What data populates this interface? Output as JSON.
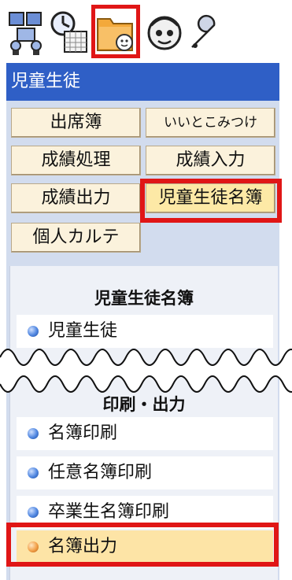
{
  "toolbar": {
    "icons": [
      "users-icon",
      "clock-calendar-icon",
      "folder-face-icon",
      "helper-face-icon",
      "wrench-icon"
    ]
  },
  "header": {
    "title": "児童生徒"
  },
  "menu": {
    "attendance": "出席簿",
    "good_points": "いいとこみつけ",
    "grade_processing": "成績処理",
    "grade_input": "成績入力",
    "grade_output": "成績出力",
    "student_roster": "児童生徒名簿",
    "personal_chart": "個人カルテ"
  },
  "section1": {
    "title": "児童生徒名簿",
    "items": [
      "児童生徒"
    ]
  },
  "section2": {
    "title": "印刷・出力",
    "items": [
      "名簿印刷",
      "任意名簿印刷",
      "卒業生名簿印刷",
      "名簿出力"
    ]
  },
  "colors": {
    "header_bg": "#2f5fc6",
    "highlight_border": "#e01616",
    "button_bg": "#fbf2dc",
    "selected_item_bg": "#fde4a6"
  }
}
